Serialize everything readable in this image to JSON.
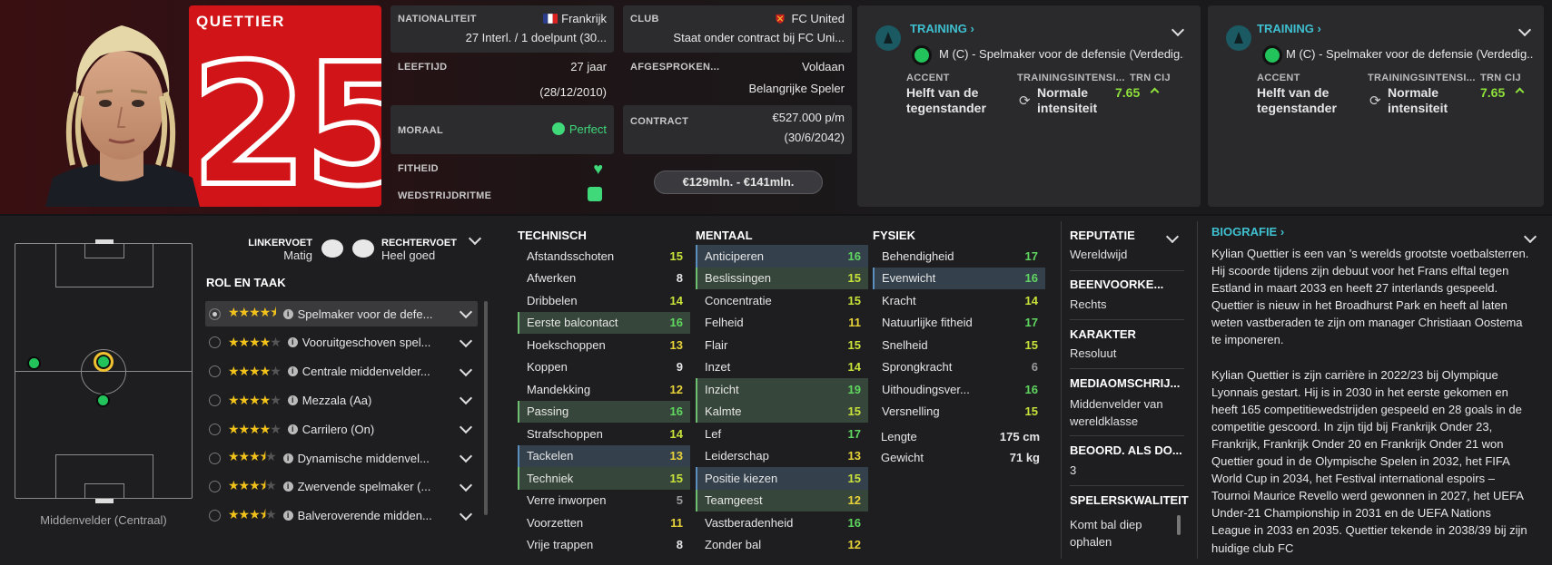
{
  "player": {
    "name": "QUETTIER",
    "number": "25"
  },
  "info": {
    "nationality_label": "NATIONALITEIT",
    "nationality": "Frankrijk",
    "caps": "27 Interl. / 1 doelpunt (30...",
    "club_label": "CLUB",
    "club": "FC United",
    "club_contract": "Staat onder contract bij FC Uni...",
    "age_label": "LEEFTIJD",
    "age": "27 jaar",
    "birth": "(28/12/2010)",
    "agreed_label": "AFGESPROKEN...",
    "agreed": "Voldaan",
    "agreed_role": "Belangrijke Speler",
    "morale_label": "MORAAL",
    "morale": "Perfect",
    "contract_label": "CONTRACT",
    "contract_wage": "€527.000 p/m",
    "contract_end": "(30/6/2042)",
    "fitness_label": "FITHEID",
    "match_label": "WEDSTRIJDRITME",
    "value": "€129mln. - €141mln."
  },
  "training": [
    {
      "title": "TRAINING",
      "role": "M (C) - Spelmaker voor de defensie (Verdedig...",
      "accent_label": "ACCENT",
      "accent": "Helft van de tegenstander",
      "intensity_label": "TRAININGSINTENSI...",
      "intensity": "Normale intensiteit",
      "rating_label": "TRN CIJ",
      "rating": "7.65"
    },
    {
      "title": "TRAINING",
      "role": "M (C) - Spelmaker voor de defensie (Verdedig...",
      "accent_label": "ACCENT",
      "accent": "Helft van de tegenstander",
      "intensity_label": "TRAININGSINTENSI...",
      "intensity": "Normale intensiteit",
      "rating_label": "TRN CIJ",
      "rating": "7.65"
    }
  ],
  "feet": {
    "left_label": "LINKERVOET",
    "left": "Matig",
    "right_label": "RECHTERVOET",
    "right": "Heel goed"
  },
  "position_label": "Middenvelder (Centraal)",
  "roles_title": "ROL EN TAAK",
  "roles": [
    {
      "name": "Spelmaker voor de defe...",
      "stars": 4.5
    },
    {
      "name": "Vooruitgeschoven spel...",
      "stars": 4
    },
    {
      "name": "Centrale middenvelder...",
      "stars": 4
    },
    {
      "name": "Mezzala (Aa)",
      "stars": 4
    },
    {
      "name": "Carrilero (On)",
      "stars": 4
    },
    {
      "name": "Dynamische middenvel...",
      "stars": 3.5
    },
    {
      "name": "Zwervende spelmaker (...",
      "stars": 3.5
    },
    {
      "name": "Balveroverende midden...",
      "stars": 3.5
    }
  ],
  "technical": {
    "title": "TECHNISCH",
    "rows": [
      {
        "n": "Afstandsschoten",
        "v": "15"
      },
      {
        "n": "Afwerken",
        "v": "8"
      },
      {
        "n": "Dribbelen",
        "v": "14"
      },
      {
        "n": "Eerste balcontact",
        "v": "16"
      },
      {
        "n": "Hoekschoppen",
        "v": "13"
      },
      {
        "n": "Koppen",
        "v": "9"
      },
      {
        "n": "Mandekking",
        "v": "12"
      },
      {
        "n": "Passing",
        "v": "16"
      },
      {
        "n": "Strafschoppen",
        "v": "14"
      },
      {
        "n": "Tackelen",
        "v": "13"
      },
      {
        "n": "Techniek",
        "v": "15"
      },
      {
        "n": "Verre inworpen",
        "v": "5"
      },
      {
        "n": "Voorzetten",
        "v": "11"
      },
      {
        "n": "Vrije trappen",
        "v": "8"
      }
    ]
  },
  "mental": {
    "title": "MENTAAL",
    "rows": [
      {
        "n": "Anticiperen",
        "v": "16"
      },
      {
        "n": "Beslissingen",
        "v": "15"
      },
      {
        "n": "Concentratie",
        "v": "15"
      },
      {
        "n": "Felheid",
        "v": "11"
      },
      {
        "n": "Flair",
        "v": "15"
      },
      {
        "n": "Inzet",
        "v": "14"
      },
      {
        "n": "Inzicht",
        "v": "19"
      },
      {
        "n": "Kalmte",
        "v": "15"
      },
      {
        "n": "Lef",
        "v": "17"
      },
      {
        "n": "Leiderschap",
        "v": "13"
      },
      {
        "n": "Positie kiezen",
        "v": "15"
      },
      {
        "n": "Teamgeest",
        "v": "12"
      },
      {
        "n": "Vastberadenheid",
        "v": "16"
      },
      {
        "n": "Zonder bal",
        "v": "12"
      }
    ]
  },
  "physical": {
    "title": "FYSIEK",
    "rows": [
      {
        "n": "Behendigheid",
        "v": "17"
      },
      {
        "n": "Evenwicht",
        "v": "16"
      },
      {
        "n": "Kracht",
        "v": "14"
      },
      {
        "n": "Natuurlijke fitheid",
        "v": "17"
      },
      {
        "n": "Snelheid",
        "v": "15"
      },
      {
        "n": "Sprongkracht",
        "v": "6"
      },
      {
        "n": "Uithoudingsver...",
        "v": "16"
      },
      {
        "n": "Versnelling",
        "v": "15"
      }
    ],
    "height_label": "Lengte",
    "height": "175 cm",
    "weight_label": "Gewicht",
    "weight": "71 kg"
  },
  "side": {
    "reputation_label": "REPUTATIE",
    "reputation": "Wereldwijd",
    "foot_label": "BEENVOORKE...",
    "foot": "Rechts",
    "character_label": "KARAKTER",
    "character": "Resoluut",
    "media_label": "MEDIAOMSCHRIJ...",
    "media": "Middenvelder van wereldklasse",
    "rating_label": "BEOORD. ALS DO...",
    "rating": "3",
    "quality_label": "SPELERSKWALITEIT",
    "quality": "Komt bal diep ophalen"
  },
  "bio": {
    "title": "BIOGRAFIE",
    "p1": "Kylian Quettier is een van 's werelds grootste voetbalsterren. Hij scoorde tijdens zijn debuut voor het Frans elftal tegen Estland in maart 2033 en heeft 27 interlands gespeeld. Quettier is nieuw in het Broadhurst Park en heeft al laten weten vastberaden te zijn om manager Christiaan Oostema te imponeren.",
    "p2": "Kylian Quettier is zijn carrière in 2022/23 bij Olympique Lyonnais gestart. Hij is in 2030 in het eerste gekomen en heeft 165 competitiewedstrijden gespeeld en 28 goals in de competitie gescoord. In zijn tijd bij Frankrijk Onder 23, Frankrijk, Frankrijk Onder 20 en Frankrijk Onder 21 won Quettier goud in de Olympische Spelen in 2032, het FIFA World Cup in 2034, het Festival international espoirs – Tournoi Maurice Revello werd gewonnen in 2027, het UEFA Under-21 Championship in 2031 en de UEFA Nations League in 2033 en 2035. Quettier tekende in 2038/39 bij zijn huidige club FC"
  },
  "colors": {
    "accent_red": "#d01418",
    "teal": "#3fc0d0",
    "green": "#22c35a"
  }
}
